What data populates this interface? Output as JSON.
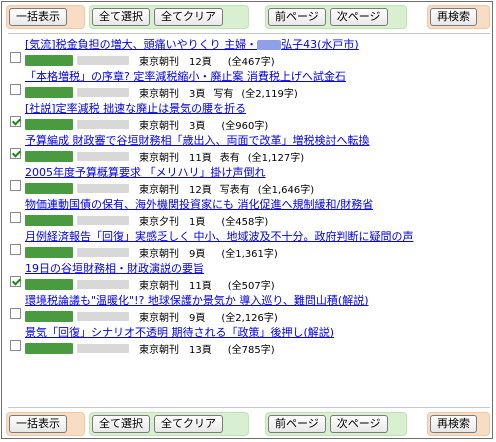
{
  "toolbar": {
    "bulk_display": "一括表示",
    "select_all": "全て選択",
    "clear_all": "全てクリア",
    "prev_page": "前ページ",
    "next_page": "次ページ",
    "research": "再検索"
  },
  "results": [
    {
      "checked": false,
      "title_pre": "[気流]税金負担の増大、頭痛いやりくり 主婦・",
      "title_post": "弘子43(水戸市)",
      "paper": "東京朝刊",
      "page": "12頁",
      "kind": "",
      "chars": "(全467字)"
    },
    {
      "checked": false,
      "title": "「本格増税」の序章? 定率減税縮小・廃止案 消費税上げへ試金石",
      "paper": "東京朝刊",
      "page": "3頁",
      "kind": "写有",
      "chars": "(全2,119字)"
    },
    {
      "checked": true,
      "title": "[社説]定率減税 拙速な廃止は景気の腰を折る",
      "paper": "東京朝刊",
      "page": "3頁",
      "kind": "",
      "chars": "(全960字)"
    },
    {
      "checked": true,
      "title": "予算編成 財政審で谷垣財務相「歳出入、両面で改革」増税検討へ転換",
      "paper": "東京朝刊",
      "page": "11頁",
      "kind": "表有",
      "chars": "(全1,127字)"
    },
    {
      "checked": false,
      "title": "2005年度予算概算要求 「メリハリ」掛け声倒れ",
      "paper": "東京朝刊",
      "page": "12頁",
      "kind": "写表有",
      "chars": "(全1,646字)"
    },
    {
      "checked": false,
      "title": "物価連動国債の保有、海外機関投資家にも 消化促進へ規制緩和/財務省",
      "paper": "東京夕刊",
      "page": "1頁",
      "kind": "",
      "chars": "(全458字)"
    },
    {
      "checked": false,
      "title": "月例経済報告「回復」実感乏しく 中小、地域波及不十分。政府判断に疑問の声",
      "paper": "東京朝刊",
      "page": "9頁",
      "kind": "",
      "chars": "(全1,361字)"
    },
    {
      "checked": true,
      "title": "19日の谷垣財務相・財政演説の要旨",
      "paper": "東京朝刊",
      "page": "11頁",
      "kind": "",
      "chars": "(全507字)"
    },
    {
      "checked": false,
      "title": "環境税論議も\"温暖化\"!? 地球保護か景気か 導入巡り、難問山積(解説)",
      "paper": "東京朝刊",
      "page": "9頁",
      "kind": "",
      "chars": "(全2,126字)"
    },
    {
      "checked": false,
      "title": "景気「回復」シナリオ不透明 期待される「政策」後押し(解説)",
      "paper": "東京朝刊",
      "page": "13頁",
      "kind": "",
      "chars": "(全785字)"
    }
  ]
}
